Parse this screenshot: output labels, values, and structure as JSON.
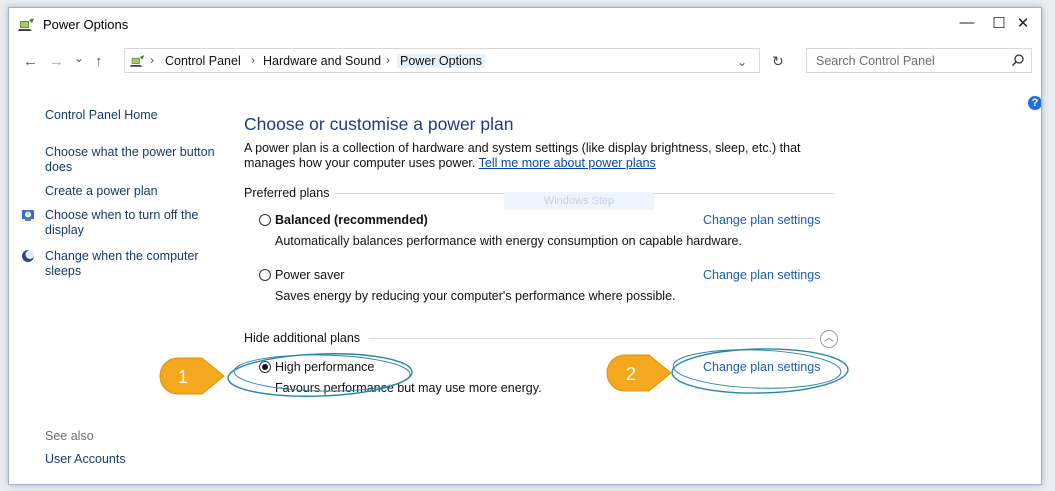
{
  "window": {
    "title": "Power Options",
    "controls": {
      "minimize": "—",
      "maximize": "☐",
      "close": "✕"
    }
  },
  "nav": {
    "back": "←",
    "forward": "→",
    "recent": "⌄",
    "up": "↑",
    "refresh": "↻",
    "dropdown": "⌄"
  },
  "breadcrumb": [
    "Control Panel",
    "Hardware and Sound",
    "Power Options"
  ],
  "search": {
    "placeholder": "Search Control Panel"
  },
  "help": "?",
  "sidebar": {
    "home": "Control Panel Home",
    "items": [
      {
        "label": "Choose what the power button does"
      },
      {
        "label": "Create a power plan"
      },
      {
        "label": "Choose when to turn off the display"
      },
      {
        "label": "Change when the computer sleeps"
      }
    ],
    "see_also": "See also",
    "see_also_items": [
      {
        "label": "User Accounts"
      }
    ]
  },
  "main": {
    "title": "Choose or customise a power plan",
    "description": "A power plan is a collection of hardware and system settings (like display brightness, sleep, etc.) that manages how your computer uses power.",
    "description_link": "Tell me more about power plans",
    "preferred_label": "Preferred plans",
    "hidden_label": "Hide additional plans",
    "ghost_text": "Windows Step",
    "plans": [
      {
        "name": "Balanced (recommended)",
        "description": "Automatically balances performance with energy consumption on capable hardware.",
        "link": "Change plan settings",
        "selected": false
      },
      {
        "name": "Power saver",
        "description": "Saves energy by reducing your computer's performance where possible.",
        "link": "Change plan settings",
        "selected": false
      },
      {
        "name": "High performance",
        "description": "Favours performance but may use more energy.",
        "link": "Change plan settings",
        "selected": true
      }
    ]
  },
  "annotations": {
    "markers": [
      "1",
      "2"
    ],
    "marker_color": "#f4a81d",
    "ellipse_color": "#2a86a8"
  }
}
